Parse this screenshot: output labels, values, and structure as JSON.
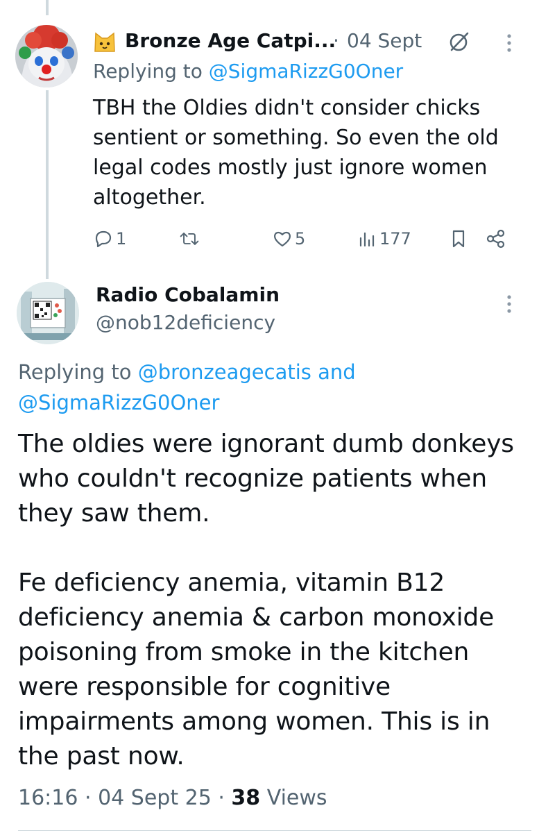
{
  "reply_tweet": {
    "author_name": "Bronze Age Catpi...",
    "date_separator": "·",
    "date": "04 Sept",
    "replying_prefix": "Replying to ",
    "replying_to": "@SigmaRizzG0Oner",
    "text": "TBH the Oldies didn't consider chicks sentient or something. So even the old legal codes mostly just ignore women altogether.",
    "actions": {
      "reply_count": "1",
      "retweet_count": "",
      "like_count": "5",
      "view_count": "177"
    },
    "icons": {
      "name_emoji": "cat-face-emoji",
      "grok": "grok-icon",
      "more": "more-vertical-icon"
    }
  },
  "main_tweet": {
    "author_name": "Radio Cobalamin",
    "handle": "@nob12deficiency",
    "replying_prefix": "Replying to ",
    "replying_to_1": "@bronzeagecatis",
    "replying_and": " and",
    "replying_to_2": "@SigmaRizzG0Oner",
    "paragraph_1": "The oldies were ignorant dumb donkeys who couldn't recognize patients when they saw them.",
    "paragraph_2": "Fe deficiency anemia, vitamin B12 deficiency anemia & carbon monoxide poisoning from smoke in the kitchen were responsible for cognitive impairments among women. This is in the past now.",
    "time": "16:16",
    "meta_sep_1": " · ",
    "date": "04 Sept 25",
    "meta_sep_2": " · ",
    "views_count": "38",
    "views_label": " Views"
  },
  "colors": {
    "text": "#0f1419",
    "secondary": "#536471",
    "link": "#1d9bf0",
    "thread_line": "#cfd9de"
  }
}
